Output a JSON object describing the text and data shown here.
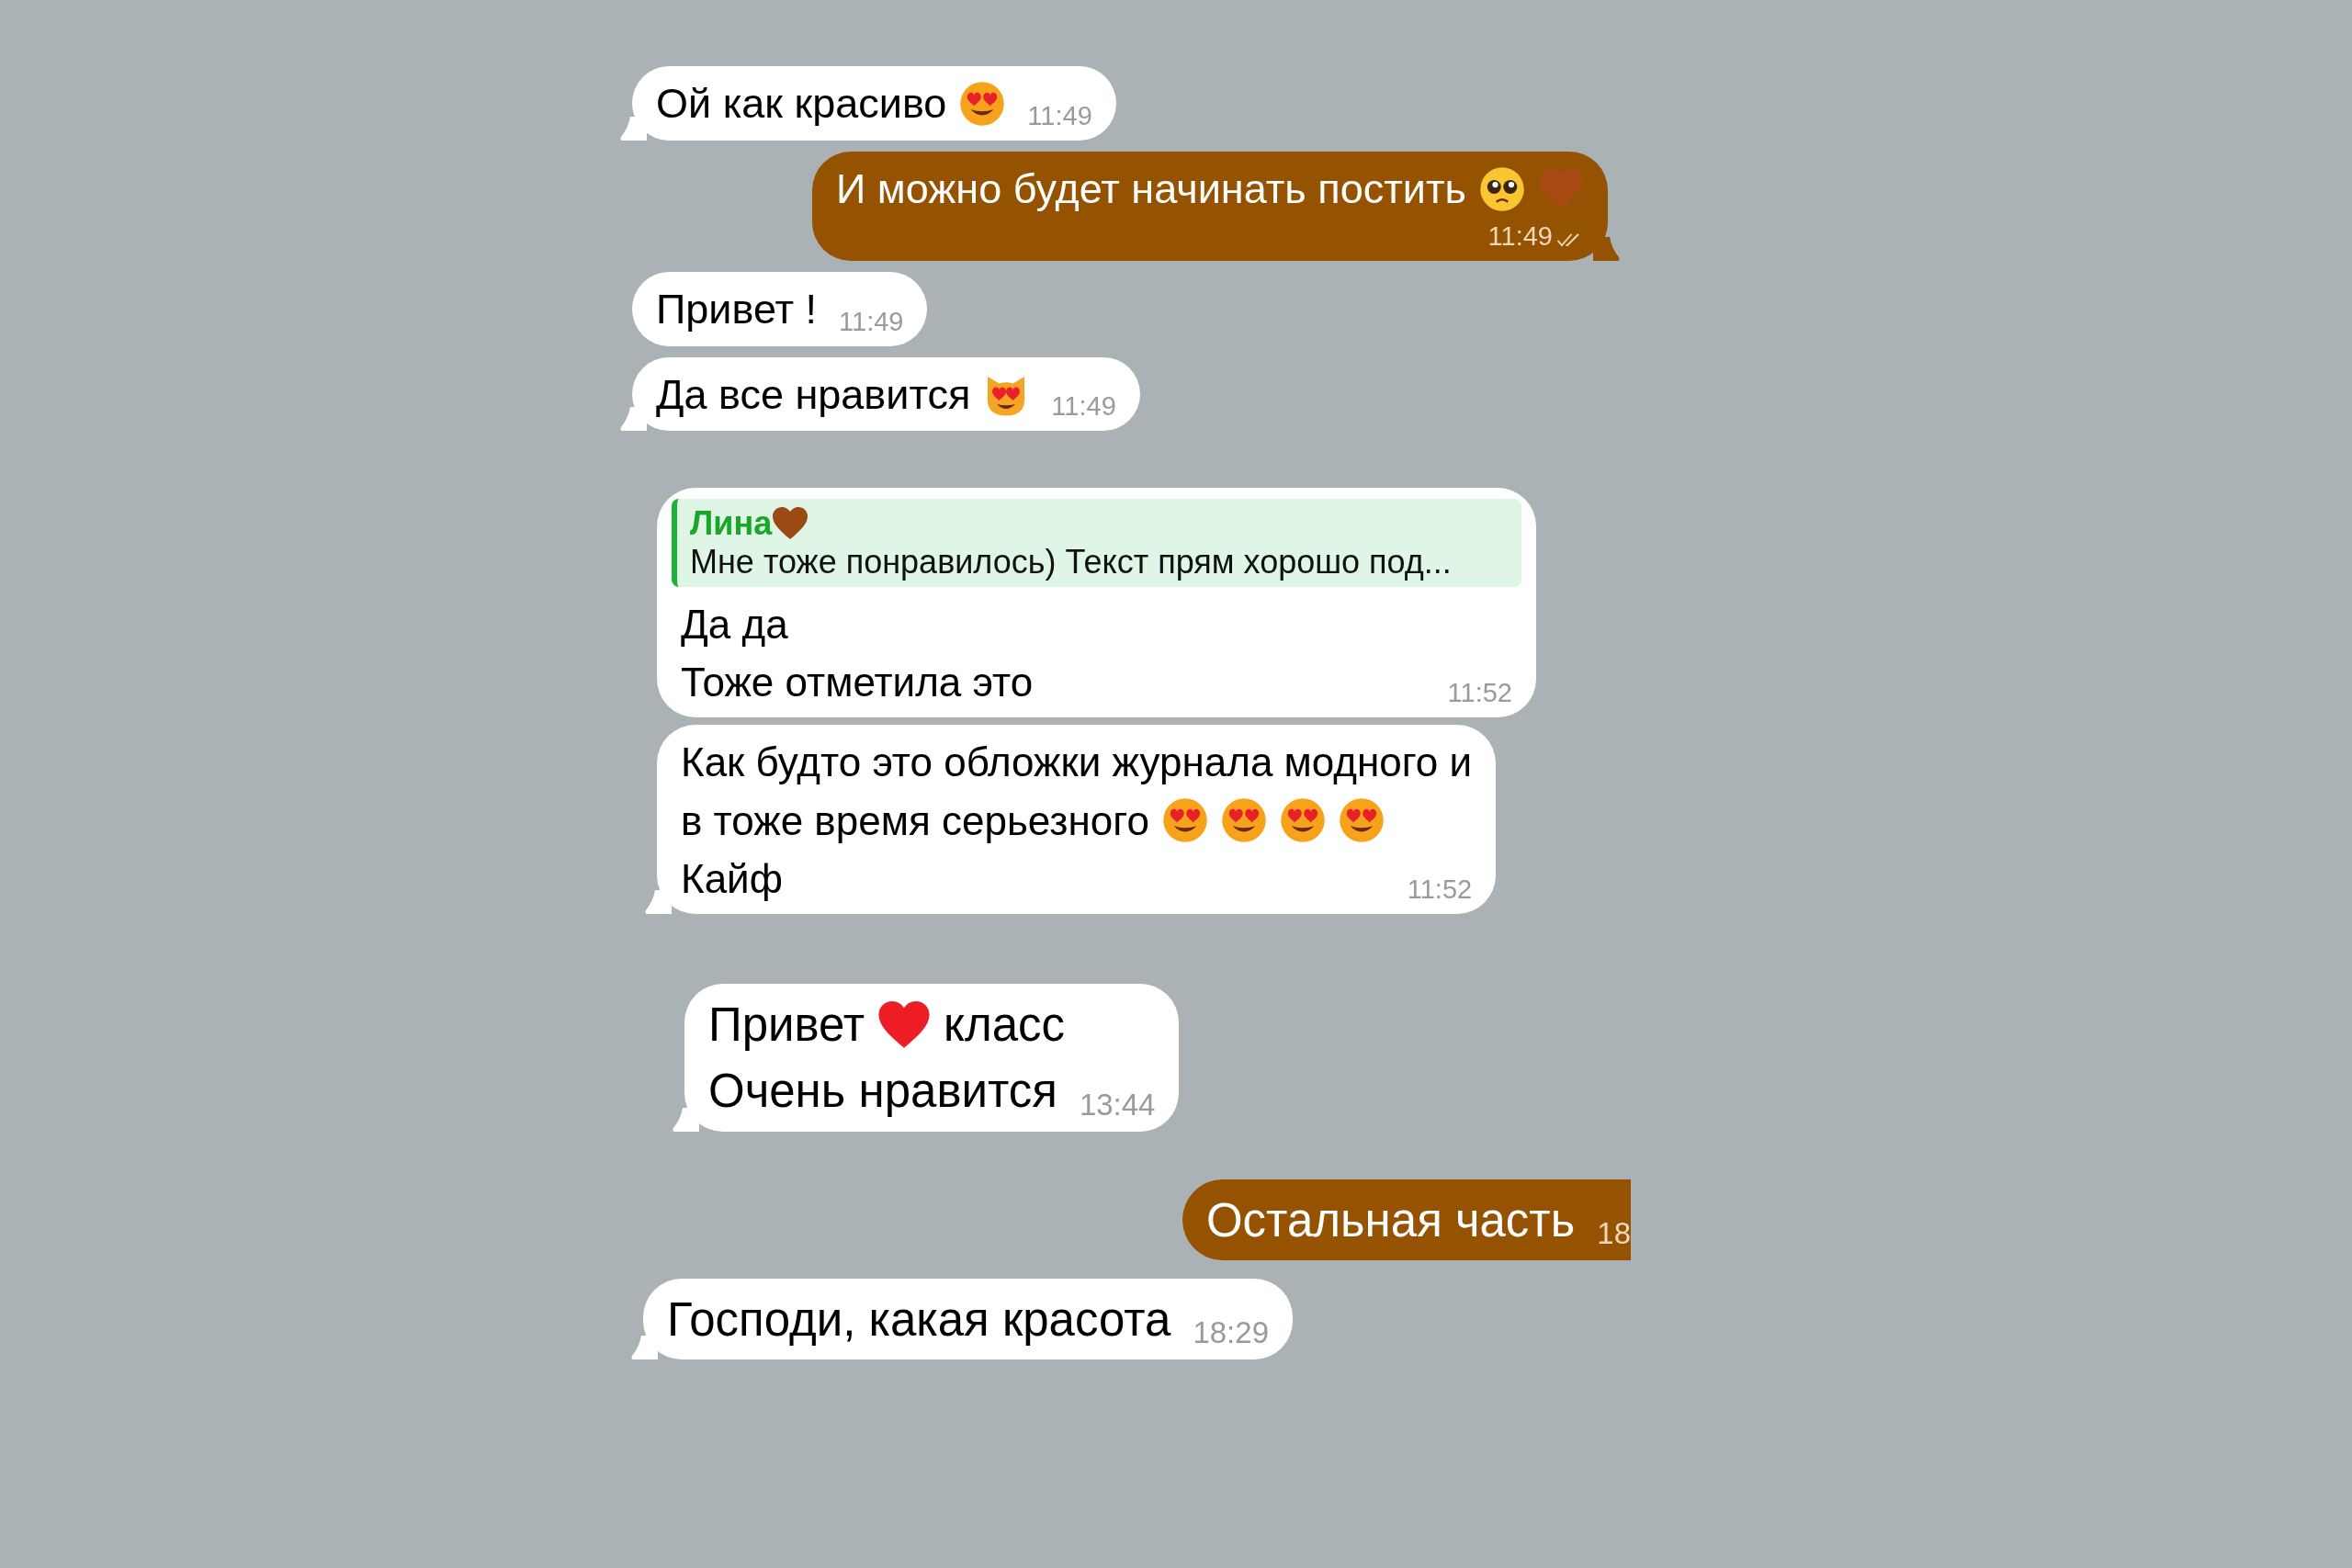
{
  "groups": [
    {
      "messages": [
        {
          "kind": "incoming",
          "tail": true,
          "lines": [
            [
              {
                "kind": "text",
                "text": "Ой как красиво"
              },
              {
                "kind": "heart_eyes"
              },
              {
                "kind": "time",
                "text": "11:49"
              }
            ]
          ]
        },
        {
          "kind": "outgoing",
          "tail": true,
          "lines": [
            [
              {
                "kind": "text",
                "text": "И можно будет начинать постить"
              },
              {
                "kind": "pleading"
              },
              {
                "kind": "heart_brown"
              }
            ],
            [
              {
                "kind": "time",
                "text": "11:49"
              },
              {
                "kind": "read_ticks"
              }
            ]
          ]
        },
        {
          "kind": "incoming",
          "tail": false,
          "lines": [
            [
              {
                "kind": "text",
                "text": "Привет !"
              },
              {
                "kind": "time",
                "text": "11:49"
              }
            ]
          ]
        },
        {
          "kind": "incoming",
          "tail": true,
          "lines": [
            [
              {
                "kind": "text",
                "text": "Да все нравится"
              },
              {
                "kind": "cat_heart_eyes"
              },
              {
                "kind": "time",
                "text": "11:49"
              }
            ]
          ]
        }
      ]
    },
    {
      "messages": [
        {
          "kind": "incoming",
          "tail": false,
          "reply": {
            "name": "Лина",
            "text": "Мне тоже понравилось) Текст прям хорошо под..."
          },
          "lines": [
            [
              {
                "kind": "text",
                "text": "Да да"
              }
            ],
            [
              {
                "kind": "text",
                "text": "Тоже отметила это"
              },
              {
                "kind": "time",
                "text": "11:52"
              }
            ]
          ]
        },
        {
          "kind": "incoming",
          "tail": true,
          "lines": [
            [
              {
                "kind": "text",
                "text": "Как будто это обложки журнала модного и"
              }
            ],
            [
              {
                "kind": "text",
                "text": "в тоже время серьезного"
              },
              {
                "kind": "heart_eyes"
              },
              {
                "kind": "heart_eyes"
              },
              {
                "kind": "heart_eyes"
              },
              {
                "kind": "heart_eyes"
              }
            ],
            [
              {
                "kind": "text",
                "text": "Кайф"
              },
              {
                "kind": "time",
                "text": "11:52"
              }
            ]
          ]
        }
      ]
    },
    {
      "messages": [
        {
          "kind": "incoming",
          "tail": true,
          "lines": [
            [
              {
                "kind": "text",
                "text": "Привет"
              },
              {
                "kind": "heart_red"
              },
              {
                "kind": "text",
                "text": "класс"
              }
            ],
            [
              {
                "kind": "text",
                "text": "Очень нравится"
              },
              {
                "kind": "time",
                "text": "13:44"
              }
            ]
          ]
        }
      ]
    },
    {
      "messages": [
        {
          "kind": "outgoing",
          "tail": false,
          "lines": [
            [
              {
                "kind": "text",
                "text": "Остальная часть"
              },
              {
                "kind": "time",
                "text": "18"
              }
            ]
          ]
        },
        {
          "kind": "incoming",
          "tail": true,
          "lines": [
            [
              {
                "kind": "text",
                "text": "Господи, какая красота"
              },
              {
                "kind": "time",
                "text": "18:29"
              }
            ]
          ]
        }
      ]
    }
  ]
}
